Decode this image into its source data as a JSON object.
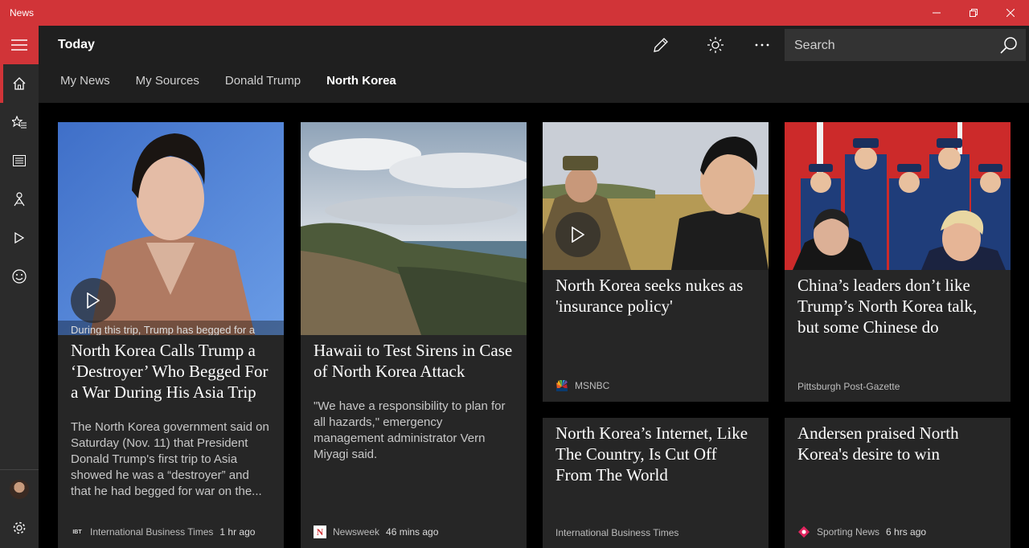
{
  "window": {
    "title": "News"
  },
  "header": {
    "title": "Today",
    "search_placeholder": "Search"
  },
  "tabs": [
    {
      "label": "My News"
    },
    {
      "label": "My Sources"
    },
    {
      "label": "Donald Trump"
    },
    {
      "label": "North Korea",
      "active": true
    }
  ],
  "rail": {
    "items": [
      "home-icon",
      "favorites-icon",
      "local-icon",
      "interests-icon",
      "video-icon",
      "emoji-icon"
    ]
  },
  "cards": [
    {
      "headline": "North Korea Calls Trump a ‘Destroyer’ Who Begged For a War During His Asia Trip",
      "image_caption": "During this trip, Trump has begged for a",
      "snippet": "The North Korea government said on Saturday (Nov. 11) that President Donald Trump's first trip to Asia showed he was a “destroyer” and that he had begged for war on the...",
      "source": "International Business Times",
      "source_logo": "IBT",
      "time": "1 hr ago"
    },
    {
      "headline": "Hawaii to Test Sirens in Case of North Korea Attack",
      "snippet": "\"We have a responsibility to plan for all hazards,\" emergency management administrator Vern Miyagi said.",
      "source": "Newsweek",
      "source_logo": "N",
      "time": "46 mins ago"
    },
    {
      "headline": "North Korea seeks nukes as 'insurance policy'",
      "source": "MSNBC"
    },
    {
      "headline": "China’s leaders don’t like Trump’s North Korea talk, but some Chinese do",
      "source": "Pittsburgh Post-Gazette"
    },
    {
      "headline": "North Korea’s Internet, Like The Country, Is Cut Off From The World",
      "source": "International Business Times"
    },
    {
      "headline": "Andersen praised North Korea's desire to win",
      "source": "Sporting News",
      "time": "6 hrs ago"
    }
  ],
  "colors": {
    "accent": "#d13438",
    "rail_bg": "#2b2b2b",
    "header_bg": "#1f1f1f",
    "card_bg": "#262626"
  }
}
